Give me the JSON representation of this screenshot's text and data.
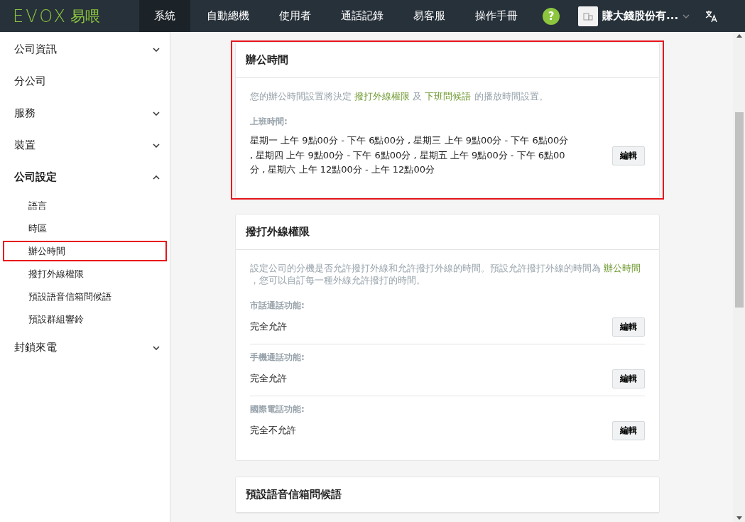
{
  "logo": {
    "mark": "EVOX",
    "name": "易喂"
  },
  "nav": [
    {
      "label": "系統",
      "selected": true
    },
    {
      "label": "自動總機",
      "selected": false
    },
    {
      "label": "使用者",
      "selected": false
    },
    {
      "label": "通話記錄",
      "selected": false
    },
    {
      "label": "易客服",
      "selected": false
    },
    {
      "label": "操作手冊",
      "selected": false
    }
  ],
  "help": "?",
  "company": "賺大錢股份有...",
  "sidebar": [
    {
      "label": "公司資訊",
      "expanded": false,
      "expandable": true
    },
    {
      "label": "分公司",
      "expanded": false,
      "expandable": false
    },
    {
      "label": "服務",
      "expanded": false,
      "expandable": true
    },
    {
      "label": "裝置",
      "expanded": false,
      "expandable": true
    },
    {
      "label": "公司設定",
      "expanded": true,
      "expandable": true,
      "children": [
        {
          "label": "語言",
          "selected": false
        },
        {
          "label": "時區",
          "selected": false
        },
        {
          "label": "辦公時間",
          "selected": true
        },
        {
          "label": "撥打外線權限",
          "selected": false
        },
        {
          "label": "預設語音信箱問候語",
          "selected": false
        },
        {
          "label": "預設群組響鈴",
          "selected": false
        }
      ]
    },
    {
      "label": "封鎖來電",
      "expanded": false,
      "expandable": true
    }
  ],
  "sections": [
    {
      "title": "辦公時間",
      "highlighted": true,
      "description": [
        {
          "kind": "text",
          "text": "您的辦公時間設置將決定 "
        },
        {
          "kind": "link",
          "text": "撥打外線權限"
        },
        {
          "kind": "text",
          "text": " 及 "
        },
        {
          "kind": "link",
          "text": "下班問候語"
        },
        {
          "kind": "text",
          "text": " 的播放時間設置。"
        }
      ],
      "fields": [
        {
          "label": "上班時間:",
          "value": "星期一 上午 9點00分 - 下午 6點00分 , 星期三 上午 9點00分 - 下午 6點00分 , 星期四 上午 9點00分 - 下午 6點00分 , 星期五 上午 9點00分 - 下午 6點00分 , 星期六 上午 12點00分 - 上午 12點00分",
          "button": "編輯"
        }
      ]
    },
    {
      "title": "撥打外線權限",
      "highlighted": false,
      "description": [
        {
          "kind": "text",
          "text": "設定公司的分機是否允許撥打外線和允許撥打外線的時間。預設允許撥打外線的時間為 "
        },
        {
          "kind": "link",
          "text": "辦公時間"
        },
        {
          "kind": "text",
          "text": " ，您可以自訂每一種外線允許撥打的時間。"
        }
      ],
      "fields": [
        {
          "label": "市話通話功能:",
          "value": "完全允許",
          "button": "編輯"
        },
        {
          "label": "手機通話功能:",
          "value": "完全允許",
          "button": "編輯"
        },
        {
          "label": "國際電話功能:",
          "value": "完全不允許",
          "button": "編輯"
        }
      ]
    },
    {
      "title": "預設語音信箱問候語",
      "highlighted": false
    }
  ]
}
